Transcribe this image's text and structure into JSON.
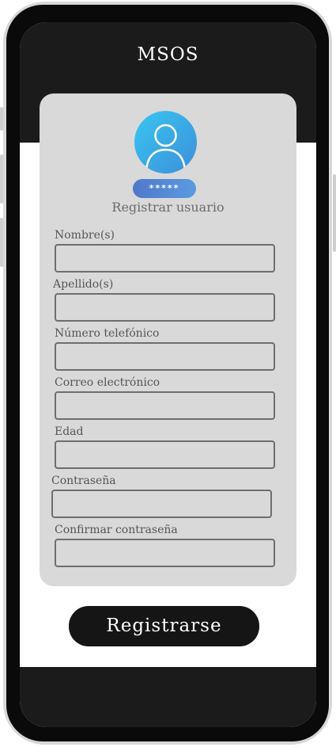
{
  "app": {
    "title": "MSOS"
  },
  "card": {
    "title": "Registrar usuario",
    "pin_badge": "*****"
  },
  "form": {
    "fields": [
      {
        "label": "Nombre(s)",
        "value": "",
        "placeholder": ""
      },
      {
        "label": "Apellido(s)",
        "value": "",
        "placeholder": ""
      },
      {
        "label": "Número telefónico",
        "value": "",
        "placeholder": ""
      },
      {
        "label": "Correo electrónico",
        "value": "",
        "placeholder": ""
      },
      {
        "label": "Edad",
        "value": "",
        "placeholder": ""
      },
      {
        "label": "Contraseña",
        "value": "",
        "placeholder": ""
      },
      {
        "label": "Confirmar contraseña",
        "value": "",
        "placeholder": ""
      }
    ],
    "submit_label": "Registrarse"
  },
  "icons": {
    "avatar": "user-avatar-icon"
  },
  "colors": {
    "header": "#1b1b1b",
    "card": "#d9d9d9",
    "button": "#151515",
    "avatar_gradient_start": "#38c6f1",
    "avatar_gradient_end": "#3d8fd8"
  }
}
